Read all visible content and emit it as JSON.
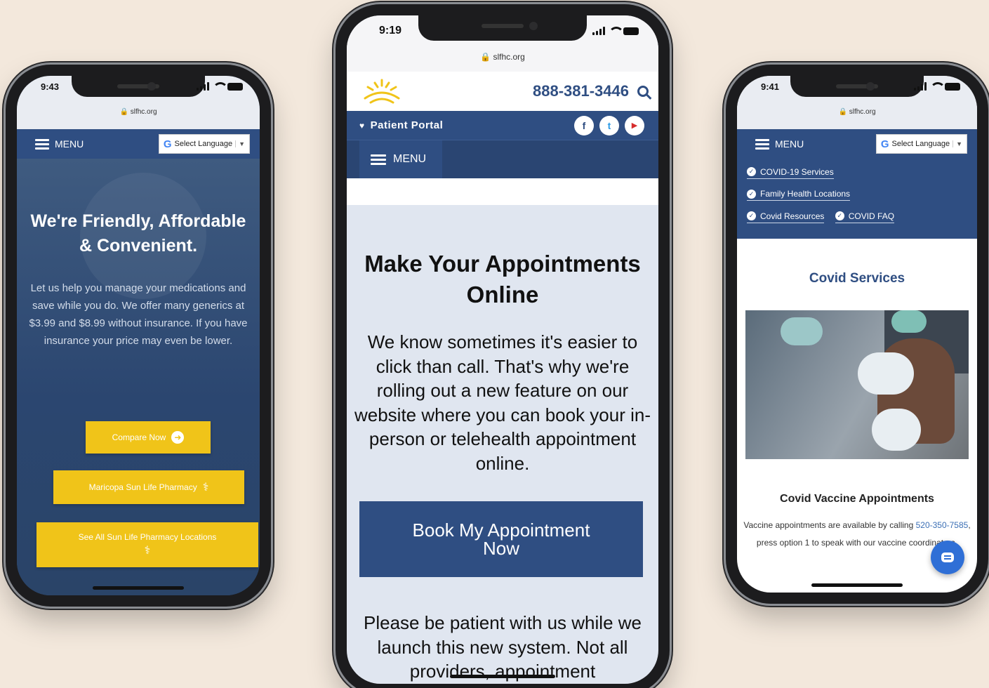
{
  "left": {
    "time": "9:43",
    "url": "slfhc.org",
    "menu_label": "MENU",
    "language_label": "Select Language",
    "headline": "We're Friendly, Affordable & Convenient.",
    "body": "Let us help you manage your medications and save while you do. We offer many generics at $3.99 and $8.99 without insurance. If you have insurance your price may even be lower.",
    "btn_compare": "Compare Now",
    "btn_pharmacy": "Maricopa Sun Life Pharmacy",
    "btn_locations": "See All Sun Life Pharmacy Locations"
  },
  "center": {
    "time": "9:19",
    "url": "slfhc.org",
    "phone_number": "888-381-3446",
    "portal_label": "Patient Portal",
    "socials": [
      "f",
      "t",
      "▶"
    ],
    "menu_label": "MENU",
    "title": "Make Your Appointments Online",
    "body": "We know sometimes it's easier to click than call. That's why we're rolling out a new feature on our website where you can book your in-person or telehealth appointment online.",
    "book_button": "Book My Appointment Now",
    "note": "Please be patient with us while we launch this new system. Not all providers, appointment"
  },
  "right": {
    "time": "9:41",
    "url": "slfhc.org",
    "menu_label": "MENU",
    "language_label": "Select Language",
    "links": [
      "COVID-19 Services",
      "Family Health Locations",
      "Covid Resources",
      "COVID FAQ"
    ],
    "section_title": "Covid Services",
    "subheading": "Covid Vaccine Appointments",
    "text_before": "Vaccine appointments are available by calling",
    "tel": "520-350-7585",
    "text_after": ", press option 1 to speak with our vaccine coordinators."
  },
  "colors": {
    "background": "#f3e8dc",
    "brand_blue": "#2f4e82",
    "accent_yellow": "#f0c419",
    "chat_blue": "#2f6fd6"
  }
}
